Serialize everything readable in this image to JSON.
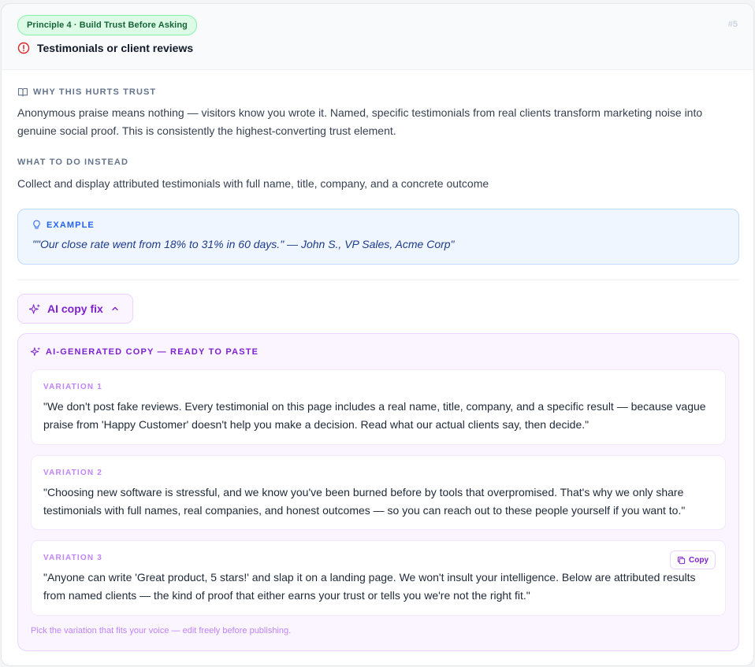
{
  "header": {
    "principle_badge": "Principle 4 · Build Trust Before Asking",
    "issue_number": "#5",
    "issue_title": "Testimonials or client reviews"
  },
  "why": {
    "label": "WHY THIS HURTS TRUST",
    "text": "Anonymous praise means nothing — visitors know you wrote it. Named, specific testimonials from real clients transform marketing noise into genuine social proof. This is consistently the highest-converting trust element."
  },
  "instead": {
    "label": "WHAT TO DO INSTEAD",
    "text": "Collect and display attributed testimonials with full name, title, company, and a concrete outcome"
  },
  "example": {
    "label": "EXAMPLE",
    "text": "\"\"Our close rate went from 18% to 31% in 60 days.\" — John S., VP Sales, Acme Corp\""
  },
  "ai": {
    "toggle_label": "AI copy fix",
    "panel_label": "AI-GENERATED COPY — READY TO PASTE",
    "copy_label": "Copy",
    "footer": "Pick the variation that fits your voice — edit freely before publishing.",
    "variations": [
      {
        "label": "VARIATION 1",
        "text": "\"We don't post fake reviews. Every testimonial on this page includes a real name, title, company, and a specific result — because vague praise from 'Happy Customer' doesn't help you make a decision. Read what our actual clients say, then decide.\""
      },
      {
        "label": "VARIATION 2",
        "text": "\"Choosing new software is stressful, and we know you've been burned before by tools that overpromised. That's why we only share testimonials with full names, real companies, and honest outcomes — so you can reach out to these people yourself if you want to.\""
      },
      {
        "label": "VARIATION 3",
        "text": "\"Anyone can write 'Great product, 5 stars!' and slap it on a landing page. We won't insult your intelligence. Below are attributed results from named clients — the kind of proof that either earns your trust or tells you we're not the right fit.\""
      }
    ]
  },
  "colors": {
    "principle_badge_bg": "#dcfce7",
    "alert": "#dc2626",
    "example_accent": "#2563eb",
    "ai_accent": "#7e22ce"
  },
  "icons": {
    "issue": "alert-circle-icon",
    "why": "book-open-icon",
    "example": "lightbulb-icon",
    "ai": "sparkles-icon",
    "toggle": "chevron-up-icon",
    "copy": "copy-icon"
  }
}
